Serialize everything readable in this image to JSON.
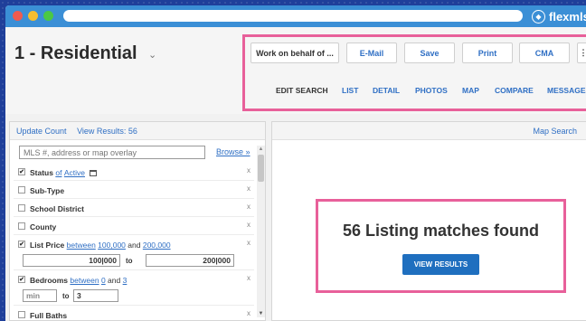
{
  "browser": {
    "brand_name": "flexmls",
    "brand_icon": "compass-icon"
  },
  "header": {
    "title": "1 - Residential",
    "title_chevron": "⌄"
  },
  "toolbar": {
    "buttons": [
      {
        "label": "Work on behalf of ..."
      },
      {
        "label": "E-Mail"
      },
      {
        "label": "Save"
      },
      {
        "label": "Print"
      },
      {
        "label": "CMA"
      },
      {
        "label": "⋮"
      }
    ],
    "tabs": [
      {
        "label": "EDIT SEARCH",
        "active": true
      },
      {
        "label": "LIST"
      },
      {
        "label": "DETAIL"
      },
      {
        "label": "PHOTOS"
      },
      {
        "label": "MAP"
      },
      {
        "label": "COMPARE"
      },
      {
        "label": "MESSAGES"
      }
    ]
  },
  "left_panel": {
    "update_count": "Update Count",
    "view_results": "View Results: 56",
    "search_placeholder": "MLS #, address or map overlay",
    "browse": "Browse »",
    "filters": [
      {
        "checked": true,
        "label": "Status",
        "of": "of",
        "link": "Active"
      },
      {
        "checked": false,
        "label": "Sub-Type"
      },
      {
        "checked": false,
        "label": "School District"
      },
      {
        "checked": false,
        "label": "County"
      },
      {
        "checked": true,
        "label": "List Price",
        "link": "between",
        "low": "100,000",
        "and": "and",
        "high": "200,000"
      },
      {
        "checked": true,
        "label": "Bedrooms",
        "link": "between",
        "low": "0",
        "and": "and",
        "high": "3"
      },
      {
        "checked": false,
        "label": "Full Baths"
      }
    ],
    "price_range": {
      "from": "100|000",
      "to_label": "to",
      "to": "200|000"
    },
    "bedroom_range": {
      "from_placeholder": "min",
      "to_label": "to",
      "to": "3"
    },
    "remove_symbol": "x"
  },
  "right_panel": {
    "header": "Map Search",
    "result_text": "56 Listing matches found",
    "button": "VIEW RESULTS"
  },
  "colors": {
    "background": "#1f3f9a",
    "titlebar": "#3b8fd6",
    "highlight": "#e8609a",
    "link": "#2f6fc4",
    "primary_button": "#1f6fbf"
  }
}
